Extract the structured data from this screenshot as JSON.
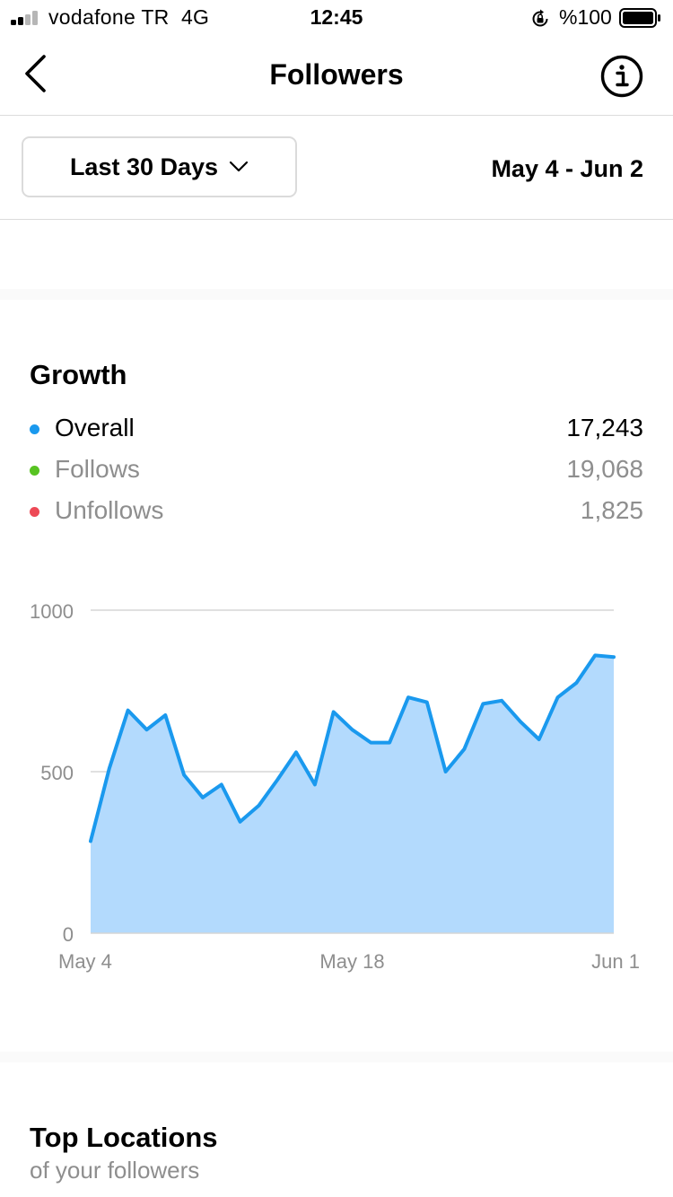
{
  "status_bar": {
    "carrier": "vodafone TR",
    "network": "4G",
    "time": "12:45",
    "battery": "%100",
    "icons": [
      "signal-icon",
      "orientation-lock-icon",
      "battery-icon"
    ]
  },
  "nav": {
    "title": "Followers",
    "back_icon": "chevron-left-icon",
    "info_icon": "info-icon"
  },
  "filter": {
    "range_label": "Last 30 Days",
    "range_icon": "chevron-down-icon",
    "date_range": "May 4 - Jun 2"
  },
  "growth": {
    "title": "Growth",
    "legend": [
      {
        "label": "Overall",
        "value": "17,243",
        "color": "#1a99ee",
        "text_color": "#000000"
      },
      {
        "label": "Follows",
        "value": "19,068",
        "color": "#58c322",
        "text_color": "#8e8e8e"
      },
      {
        "label": "Unfollows",
        "value": "1,825",
        "color": "#ed4956",
        "text_color": "#8e8e8e"
      }
    ]
  },
  "chart_data": {
    "type": "area",
    "ylim": [
      0,
      1000
    ],
    "y_ticks": [
      "0",
      "500",
      "1000"
    ],
    "x_tick_labels": [
      "May 4",
      "May 18",
      "Jun 1"
    ],
    "grid": true,
    "series": [
      {
        "line_color": "#1a99ee",
        "fill_color": "#b3dafd",
        "x": [
          "May 4",
          "May 5",
          "May 6",
          "May 7",
          "May 8",
          "May 9",
          "May 10",
          "May 11",
          "May 12",
          "May 13",
          "May 14",
          "May 15",
          "May 16",
          "May 17",
          "May 18",
          "May 19",
          "May 20",
          "May 21",
          "May 22",
          "May 23",
          "May 24",
          "May 25",
          "May 26",
          "May 27",
          "May 28",
          "May 29",
          "May 30",
          "May 31",
          "Jun 1"
        ],
        "values": [
          285,
          510,
          690,
          630,
          675,
          490,
          420,
          460,
          345,
          395,
          475,
          560,
          460,
          685,
          630,
          590,
          590,
          730,
          715,
          500,
          570,
          710,
          720,
          655,
          600,
          730,
          775,
          860,
          855
        ]
      }
    ]
  },
  "locations": {
    "title": "Top Locations",
    "subtitle": "of your followers"
  }
}
